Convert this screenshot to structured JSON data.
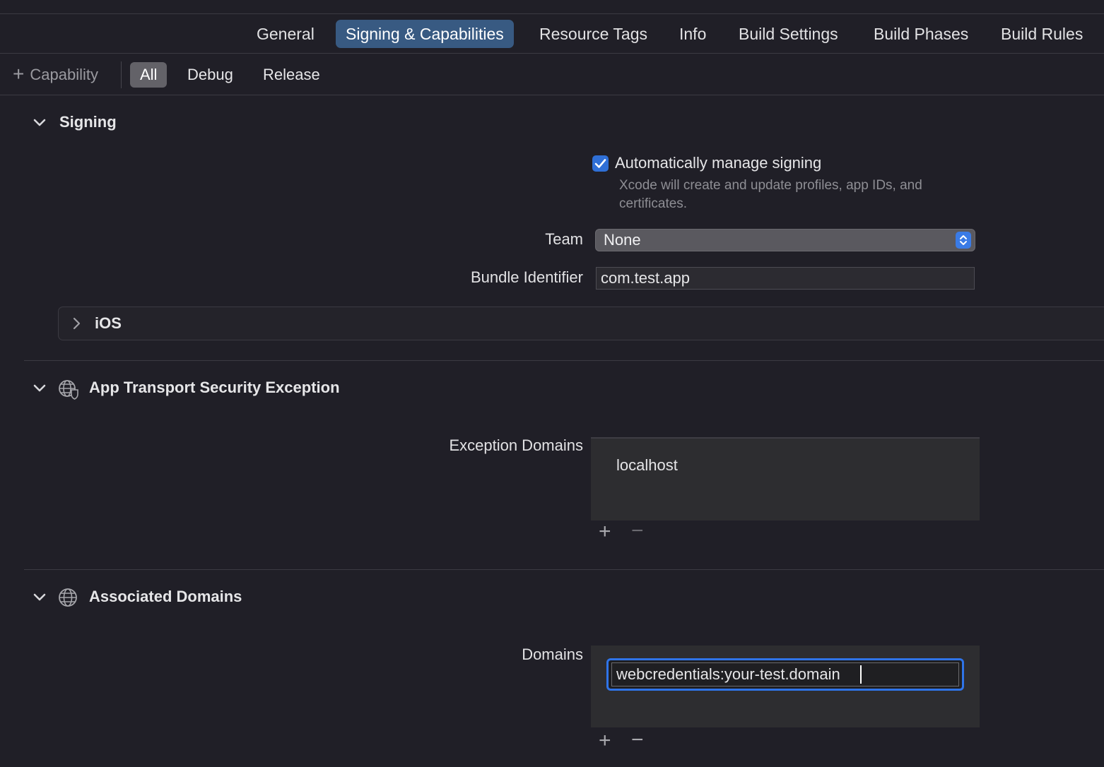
{
  "tabs": [
    {
      "label": "General",
      "active": false
    },
    {
      "label": "Signing & Capabilities",
      "active": true
    },
    {
      "label": "Resource Tags",
      "active": false
    },
    {
      "label": "Info",
      "active": false
    },
    {
      "label": "Build Settings",
      "active": false
    },
    {
      "label": "Build Phases",
      "active": false
    },
    {
      "label": "Build Rules",
      "active": false
    }
  ],
  "filterbar": {
    "add_capability_label": "Capability",
    "filters": [
      {
        "label": "All",
        "active": true
      },
      {
        "label": "Debug",
        "active": false
      },
      {
        "label": "Release",
        "active": false
      }
    ]
  },
  "signing": {
    "title": "Signing",
    "auto_manage_label": "Automatically manage signing",
    "auto_manage_checked": true,
    "hint_line1": "Xcode will create and update profiles, app IDs, and",
    "hint_line2": "certificates.",
    "team_label": "Team",
    "team_value": "None",
    "bundle_label": "Bundle Identifier",
    "bundle_value": "com.test.app",
    "platform_label": "iOS"
  },
  "ats": {
    "title": "App Transport Security Exception",
    "domains_label": "Exception Domains",
    "domains": [
      "localhost"
    ]
  },
  "associated": {
    "title": "Associated Domains",
    "domains_label": "Domains",
    "editing_value": "webcredentials:your-test.domain"
  },
  "colors": {
    "background": "#201f27",
    "accent": "#2f74e8",
    "active_tab": "#385a82"
  }
}
